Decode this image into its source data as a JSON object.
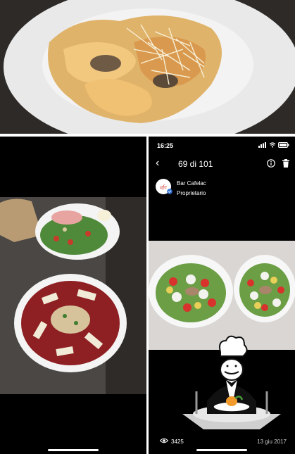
{
  "status": {
    "time": "16:25"
  },
  "nav": {
    "counter": "69 di 101"
  },
  "poster": {
    "name": "Bar Cafelac",
    "role": "Proprietario",
    "avatar_text": "afe"
  },
  "footer": {
    "views": "3425",
    "date": "13 giu 2017"
  },
  "icons": [
    "location-arrow-icon",
    "signal-icon",
    "wifi-icon",
    "battery-icon",
    "back-chevron-icon",
    "info-icon",
    "trash-icon",
    "verified-badge-icon",
    "eye-icon"
  ],
  "colors": {
    "accent_badge": "#2f6fd6",
    "logo_red": "#d23a2e"
  }
}
